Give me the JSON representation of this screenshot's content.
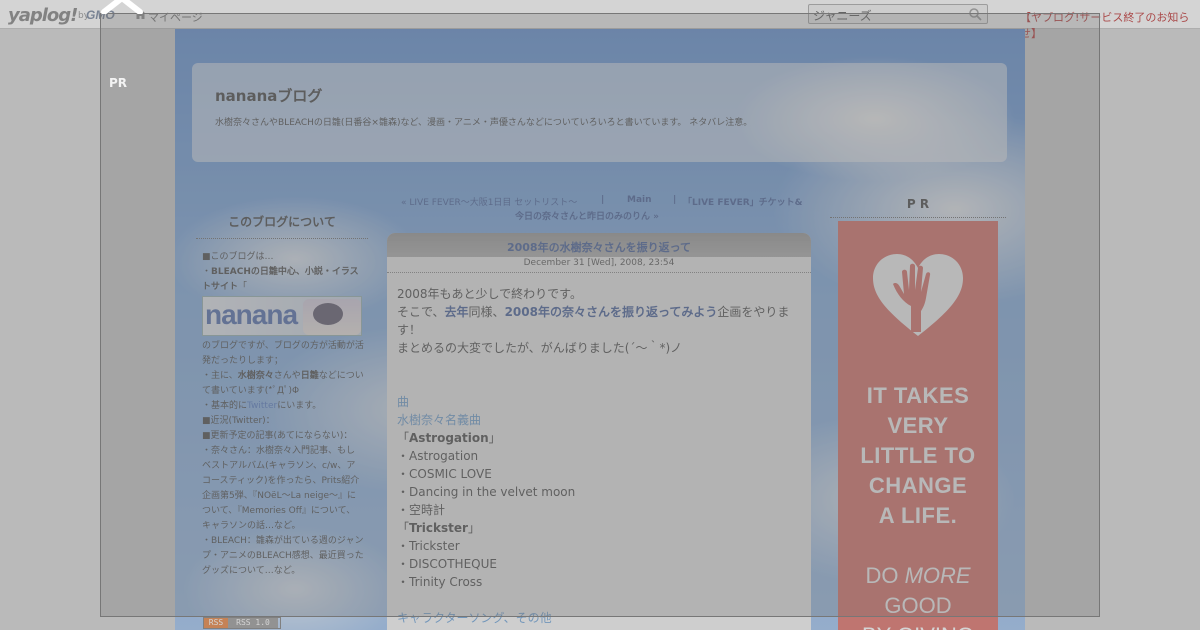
{
  "topbar": {
    "logo": "yaplog!",
    "logo_by": "by",
    "logo_gmo": "GMO",
    "mypage": "マイページ",
    "search_value": "ジャニーズ",
    "notice": "【ヤプログ!サービス終了のお知らせ】"
  },
  "blog": {
    "title": "nananaブログ",
    "description": "水樹奈々さんやBLEACHの日雛(日番谷×雛森)など、漫画・アニメ・声優さんなどについていろいろと書いています。 ネタバレ注意。"
  },
  "sidebar_left": {
    "about_title": "このブログについて",
    "banner_text": "nanana",
    "line1": "■このブログは…",
    "line2a": "・",
    "line2b": "BLEACHの日雛中心、小説・イラストサイト",
    "line2c": "「",
    "line3": "のブログですが、ブログの方が活動が活発だったりします；",
    "line4a": "・主に、",
    "line4b": "水樹奈々",
    "line4c": "さんや",
    "line4d": "日雛",
    "line4e": "などについて書いています(*ﾟДﾟ)Φ",
    "line5a": "・基本的に",
    "line5b": "Twitter",
    "line5c": "にいます。",
    "line6": "■近況(Twitter)：",
    "line7": "■更新予定の記事(あてにならない)：",
    "line8": "・奈々さん：水樹奈々入門記事、もしベストアルバム(キャラソン、c/w、アコースティック)を作ったら、Prits紹介企画第5弾、『NOëL～La neige～』について、『Memories Off』について、キャラソンの話…など。",
    "line9": "・BLEACH：雛森が出ている週のジャンプ・アニメのBLEACH感想、最近買ったグッズについて…など。",
    "rss_a": "RSS",
    "rss_b": "RSS 1.0"
  },
  "nav": {
    "prev": "« LIVE FEVER～大阪1日目 セットリスト～",
    "sep1": "|",
    "main": "Main",
    "sep2": "|",
    "next1": "「LIVE FEVER」チケット&",
    "next2": "今日の奈々さんと昨日のみのりん »"
  },
  "entry": {
    "title": "2008年の水樹奈々さんを振り返って",
    "date": "December 31 [Wed], 2008, 23:54",
    "p1": "2008年もあと少しで終わりです。",
    "p2a": "そこで、",
    "p2b": "去年",
    "p2c": "同様、",
    "p2d": "2008年の奈々さんを振り返ってみよう",
    "p2e": "企画をやります！",
    "p3": "まとめるの大変でしたが、がんばりました(´～｀*)ノ",
    "section1": "曲",
    "section2": "水樹奈々名義曲",
    "single1_open": "「",
    "single1": "Astrogation",
    "single1_close": "」",
    "s1_t1": "・Astrogation",
    "s1_t2": "・COSMIC LOVE",
    "s1_t3": "・Dancing in the velvet moon",
    "s1_t4": "・空時計",
    "single2_open": "「",
    "single2": "Trickster",
    "single2_close": "」",
    "s2_t1": "・Trickster",
    "s2_t2": "・DISCOTHEQUE",
    "s2_t3": "・Trinity Cross",
    "section3": "キャラクターソング、その他"
  },
  "sidebar_right": {
    "pr_title": "P R",
    "ad_line1": "IT TAKES",
    "ad_line2": "VERY",
    "ad_line3": "LITTLE TO",
    "ad_line4": "CHANGE",
    "ad_line5": "A LIFE.",
    "ad_sub1a": "DO ",
    "ad_sub1b": "MORE",
    "ad_sub2": "GOOD",
    "ad_sub3": "BY GIVING"
  },
  "modal": {
    "pr_left": "PR"
  },
  "colors": {
    "ad_bg": "#d9534a",
    "link": "#1d3f8c",
    "notice": "#b20000"
  }
}
